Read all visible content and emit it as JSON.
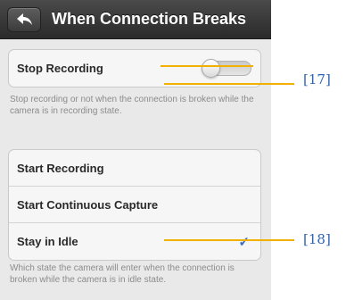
{
  "header": {
    "title": "When Connection Breaks",
    "back_icon": "back-arrow-icon"
  },
  "recording_group": {
    "stop_recording_label": "Stop Recording",
    "toggle_state": "off",
    "note": "Stop recording or not when the connection is broken while the camera is in recording state."
  },
  "idle_group": {
    "options": [
      {
        "label": "Start Recording",
        "selected": false
      },
      {
        "label": "Start Continuous Capture",
        "selected": false
      },
      {
        "label": "Stay in Idle",
        "selected": true
      }
    ],
    "check_icon": "checkmark-icon",
    "note": "Which state the camera will enter when the connection is broken while the camera is in idle state."
  },
  "annotations": {
    "callout_1": "[17]",
    "callout_2": "[18]"
  },
  "colors": {
    "accent": "#3b6fc2",
    "callout_line": "#f2b100",
    "callout_text": "#2c63b5"
  }
}
